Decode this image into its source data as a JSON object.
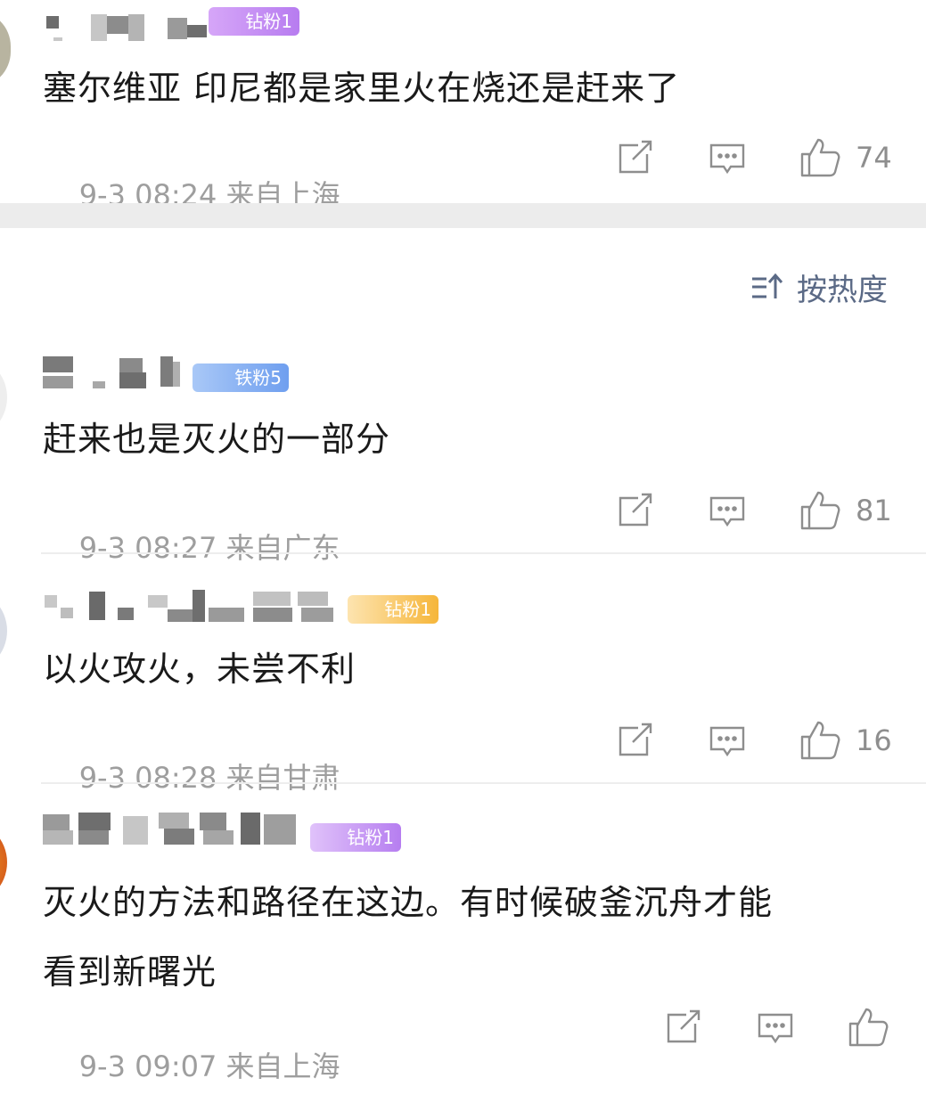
{
  "top_comment": {
    "badge": "钻粉1",
    "text": "塞尔维亚 印尼都是家里火在烧还是赶来了",
    "time": "9-3 08:24",
    "location": "来自上海",
    "likes": "74"
  },
  "sort": {
    "label": "按热度"
  },
  "comments": [
    {
      "badge": "铁粉5",
      "text": "赶来也是灭火的一部分",
      "time": "9-3 08:27",
      "location": "来自广东",
      "likes": "81"
    },
    {
      "badge": "钻粉1",
      "text": "以火攻火，未尝不利",
      "time": "9-3 08:28",
      "location": "来自甘肃",
      "likes": "16"
    },
    {
      "badge": "钻粉1",
      "text_line1": "灭火的方法和路径在这边。有时候破釜沉舟才能",
      "text_line2": "看到新曙光",
      "time": "9-3 09:07",
      "location": "来自上海",
      "likes": ""
    }
  ],
  "colors": {
    "badge_purple": "#c58cf5",
    "badge_blue": "#7aa9f2",
    "badge_gold": "#f5b83a",
    "sort_text": "#5b6a86",
    "meta_gray": "#9e9e9e"
  }
}
